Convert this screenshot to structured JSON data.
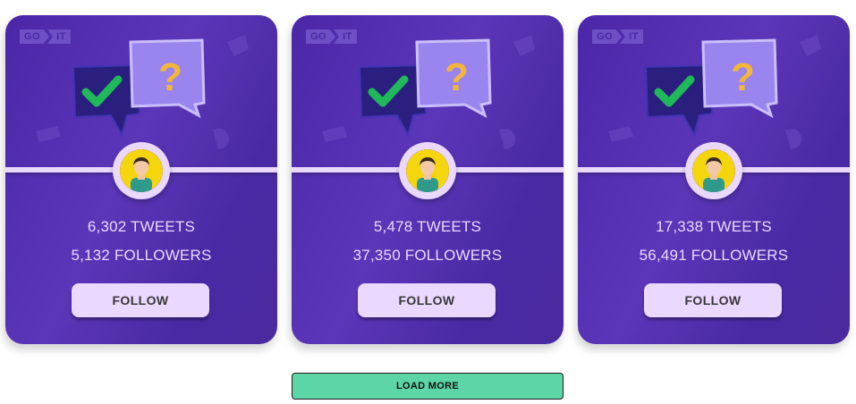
{
  "brand": {
    "logo_left": "GO",
    "logo_right": "IT"
  },
  "cards": [
    {
      "tweets": "6,302 TWEETS",
      "followers": "5,132 FOLLOWERS",
      "button_label": "FOLLOW"
    },
    {
      "tweets": "5,478 TWEETS",
      "followers": "37,350 FOLLOWERS",
      "button_label": "FOLLOW"
    },
    {
      "tweets": "17,338 TWEETS",
      "followers": "56,491 FOLLOWERS",
      "button_label": "FOLLOW"
    }
  ],
  "pagination": {
    "load_more_label": "LOAD MORE"
  },
  "colors": {
    "card_bg": "#5736b5",
    "accent_light": "#ebd8ff",
    "load_more_bg": "#5cd6a6",
    "avatar_bg": "#f5d50b"
  },
  "icons": [
    "goit-logo",
    "chat-bubbles-illustration",
    "check-mark-icon",
    "question-mark-icon",
    "user-avatar"
  ]
}
